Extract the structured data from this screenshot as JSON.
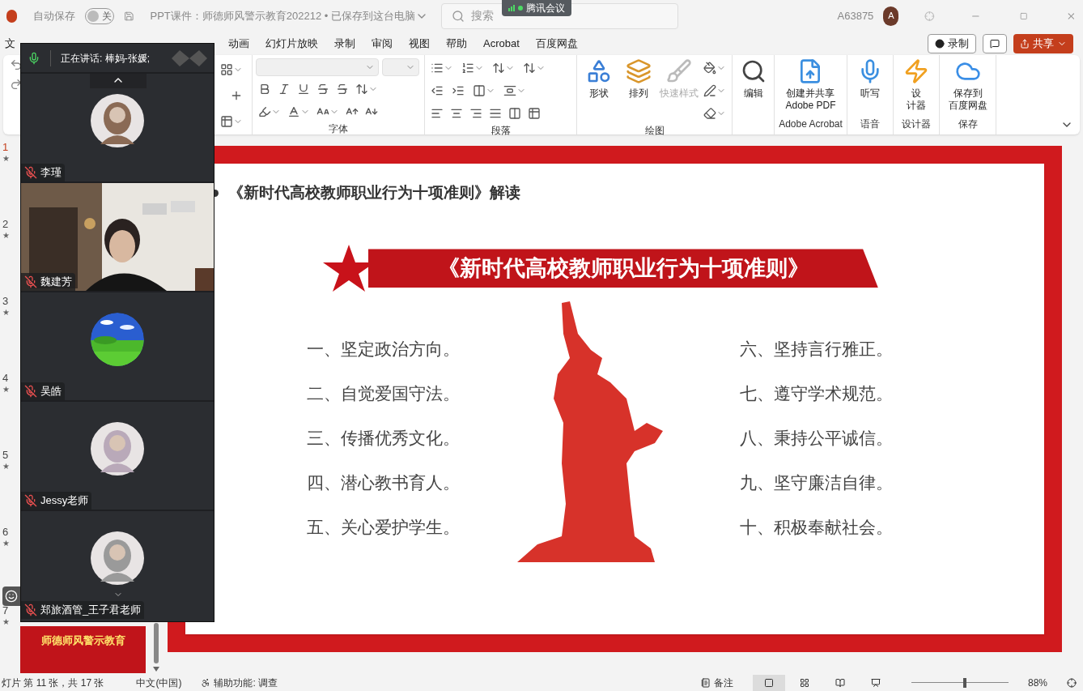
{
  "title_bar": {
    "autosave_label": "自动保存",
    "autosave": {
      "on": false,
      "label": "关"
    },
    "document_title": "PPT课件：师德师风警示教育202212 • 已保存到这台电脑",
    "search": {
      "placeholder": "搜索"
    },
    "meeting_badge": "腾讯会议",
    "user_name": "A63875",
    "avatar": "A"
  },
  "menu_tabs": [
    {
      "label": "文",
      "selected": false
    },
    {
      "label": "动画",
      "selected": false
    },
    {
      "label": "幻灯片放映",
      "selected": false
    },
    {
      "label": "录制",
      "selected": false
    },
    {
      "label": "审阅",
      "selected": false
    },
    {
      "label": "视图",
      "selected": false
    },
    {
      "label": "帮助",
      "selected": false
    },
    {
      "label": "Acrobat",
      "selected": false
    },
    {
      "label": "百度网盘",
      "selected": false
    }
  ],
  "menu_buttons": {
    "record": "录制",
    "share": "共享"
  },
  "ribbon": [
    {
      "kind": "font",
      "label": "字体"
    },
    {
      "kind": "paragraph",
      "label": "段落"
    },
    {
      "kind": "drawing",
      "label": "绘图",
      "buttons": [
        {
          "kind": "shape",
          "label": "形状",
          "disabled": false
        },
        {
          "kind": "arrange",
          "label": "排列",
          "disabled": false
        },
        {
          "kind": "style",
          "label": "快速样式",
          "disabled": true
        }
      ]
    },
    {
      "kind": "editing",
      "buttons": [
        {
          "kind": "find",
          "label": "编辑",
          "disabled": false
        }
      ]
    },
    {
      "kind": "acrobat",
      "label": "Adobe Acrobat",
      "buttons": [
        {
          "kind": "pdf",
          "label": "创建并共享\nAdobe PDF",
          "disabled": false
        }
      ]
    },
    {
      "kind": "voice",
      "label": "语音",
      "buttons": [
        {
          "kind": "mic",
          "label": "听写",
          "disabled": false
        }
      ]
    },
    {
      "kind": "designer",
      "label": "设计器",
      "buttons": [
        {
          "kind": "designer",
          "label": "设计器",
          "disabled": false
        }
      ]
    },
    {
      "kind": "save",
      "label": "保存",
      "buttons": [
        {
          "kind": "cloud",
          "label": "保存到百度网盘",
          "disabled": false
        }
      ]
    }
  ],
  "thumbnails": [
    {
      "number": "1",
      "mark": "★",
      "selected": true
    },
    {
      "number": "2",
      "mark": "★",
      "selected": false
    },
    {
      "number": "3",
      "mark": "★",
      "selected": false
    },
    {
      "number": "4",
      "mark": "★",
      "selected": false
    },
    {
      "number": "5",
      "mark": "★",
      "selected": false
    },
    {
      "number": "6",
      "mark": "★",
      "selected": false
    },
    {
      "number": "7",
      "mark": "★",
      "selected": false,
      "title": "师德师风警示教育"
    }
  ],
  "slide": {
    "heading": "《新时代高校教师职业行为十项准则》解读",
    "banner": "《新时代高校教师职业行为十项准则》",
    "left_items": [
      "一、坚定政治方向。",
      "二、自觉爱国守法。",
      "三、传播优秀文化。",
      "四、潜心教书育人。",
      "五、关心爱护学生。"
    ],
    "right_items": [
      "六、坚持言行雅正。",
      "七、遵守学术规范。",
      "八、秉持公平诚信。",
      "九、坚守廉洁自律。",
      "十、积极奉献社会。"
    ]
  },
  "meeting": {
    "speaking": "正在讲话: 棒妈-张媛;",
    "participants": [
      {
        "name": "李瑾",
        "kind": "avatar",
        "muted": true,
        "color": "#8a6a55"
      },
      {
        "name": "魏建芳",
        "kind": "video",
        "muted": true
      },
      {
        "name": "吴皓",
        "kind": "landscape",
        "muted": true
      },
      {
        "name": "Jessy老师",
        "kind": "avatar",
        "muted": true,
        "color": "#b9a9b9"
      },
      {
        "name": "郑旅酒管_王子君老师",
        "kind": "avatar",
        "muted": true,
        "color": "#9a9a9a"
      }
    ]
  },
  "status_bar": {
    "slide_info": "灯片 第 11 张，共 17 张",
    "language": "中文(中国)",
    "accessibility": "辅助功能: 调查",
    "notes": "备注",
    "views": [
      {
        "selected": true
      },
      {
        "selected": false
      },
      {
        "selected": false
      },
      {
        "selected": false
      }
    ],
    "zoom_slider": {
      "level": 0.55
    },
    "zoom": "88%"
  }
}
